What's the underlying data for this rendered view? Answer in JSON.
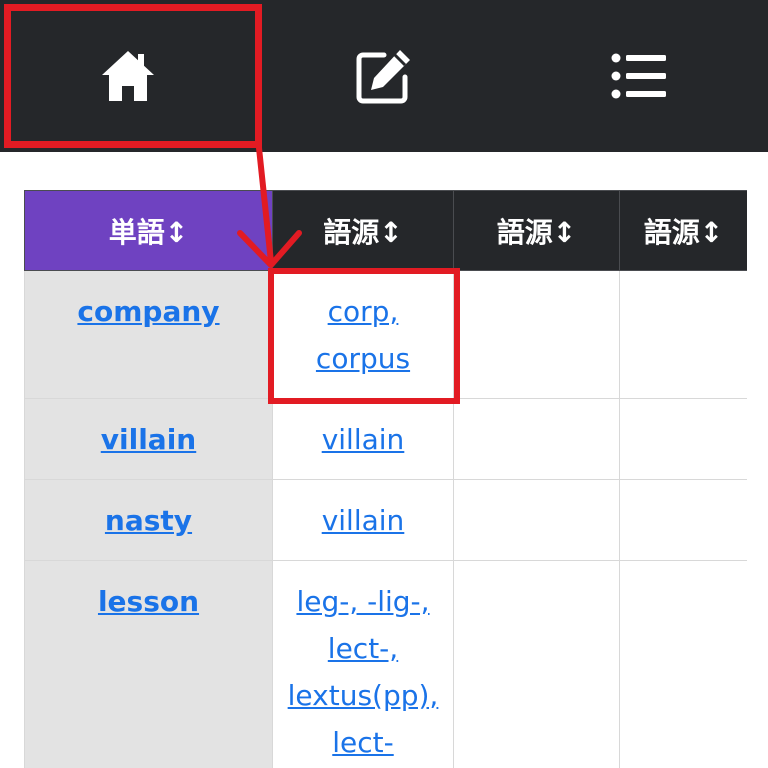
{
  "nav": {
    "items": [
      {
        "icon": "home-icon"
      },
      {
        "icon": "edit-icon"
      },
      {
        "icon": "list-icon"
      }
    ],
    "active_index": 0
  },
  "table": {
    "headers": [
      "単語↕",
      "語源↕",
      "語源↕",
      "語源↕"
    ],
    "rows": [
      {
        "word": "company",
        "etymology": [
          "corp,",
          "corpus"
        ]
      },
      {
        "word": "villain",
        "etymology": [
          "villain"
        ]
      },
      {
        "word": "nasty",
        "etymology": [
          "villain"
        ]
      },
      {
        "word": "lesson",
        "etymology": [
          "leg-, -lig-,",
          "lect-,",
          "lextus(pp),",
          "lect-"
        ]
      }
    ]
  },
  "colors": {
    "nav_bg": "#25272a",
    "header_bg": "#25272a",
    "header_first_bg": "#6f42c1",
    "word_col_bg": "#e3e3e3",
    "link": "#1a73e8",
    "annotation": "#e21b23"
  }
}
